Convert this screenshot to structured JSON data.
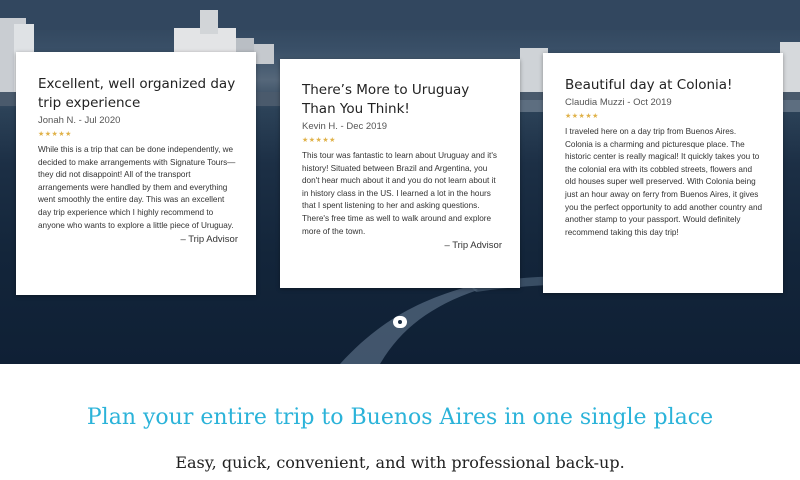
{
  "testimonials": [
    {
      "title": "Excellent, well organized day trip experience",
      "author": "Jonah N. - Jul 2020",
      "stars": "★★★★★",
      "body": "While this is a trip that can be done independently, we decided to make arrangements with Signature Tours—they did not disappoint! All of the transport arrangements were handled by them and everything went smoothly the entire day. This was an excellent day trip experience which I highly recommend to anyone who wants to explore a little piece of Uruguay.",
      "source": "– Trip Advisor"
    },
    {
      "title": "There’s More to Uruguay Than You Think!",
      "author": "Kevin H. - Dec 2019",
      "stars": "★★★★★",
      "body": "This tour was fantastic to learn about Uruguay and it's history! Situated between Brazil and Argentina, you don't hear much about it and you do not learn about it in history class in the US. I learned a lot in the hours that I spent listening to her and asking questions. There's free time as well to walk around and explore more of the town.",
      "source": "– Trip Advisor"
    },
    {
      "title": "Beautiful day at Colonia!",
      "author": "Claudia Muzzi - Oct 2019",
      "stars": "★★★★★",
      "body": "I traveled here on a day trip from Buenos Aires. Colonia is a charming and picturesque place. The historic center is really magical! It quickly takes you to the colonial era with its cobbled streets, flowers and old houses super well preserved. With Colonia being just an hour away on ferry from Buenos Aires, it gives you the perfect opportunity to add another country and another stamp to your passport. Would definitely recommend taking this day trip!",
      "source": ""
    }
  ],
  "headline": "Plan your entire trip to Buenos Aires in one single place",
  "tagline": "Easy, quick, convenient, and with professional back-up.",
  "colors": {
    "headline": "#2bb3d9",
    "stars": "#e0b24a",
    "hero_dark": "#13253a"
  },
  "icons": {
    "slider_dot": "carousel-dot-icon",
    "rating": "star-icon"
  }
}
